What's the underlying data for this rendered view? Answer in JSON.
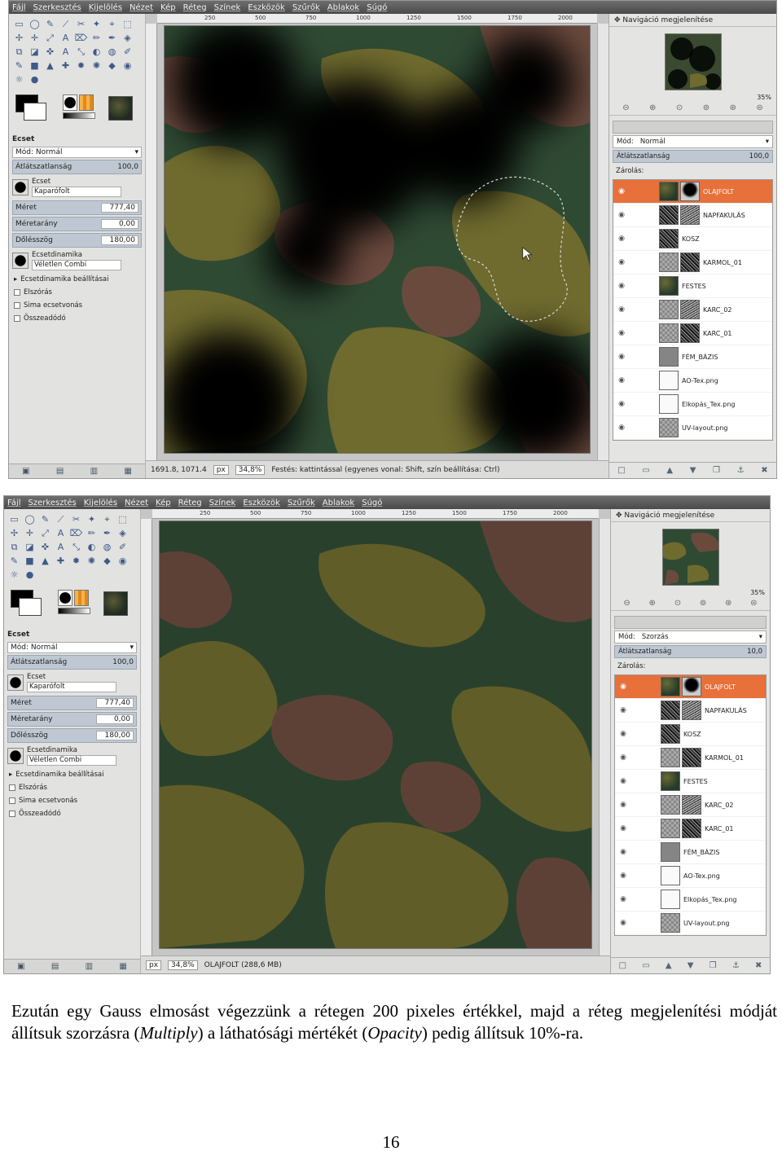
{
  "screenshot1": {
    "menu": [
      "Fájl",
      "Szerkesztés",
      "Kijelölés",
      "Nézet",
      "Kép",
      "Réteg",
      "Színek",
      "Eszközök",
      "Szűrők",
      "Ablakok",
      "Súgó"
    ],
    "ruler": [
      "250",
      "500",
      "750",
      "1000",
      "1250",
      "1500",
      "1750",
      "2000"
    ],
    "toolbox": {
      "section_title": "Ecset",
      "mode_label": "Mód:",
      "mode_value": "Normál",
      "opacity_label": "Átlátszatlanság",
      "opacity_value": "100,0",
      "brush_label": "Ecset",
      "brush_value": "Kaparófolt",
      "size_label": "Méret",
      "size_value": "777,40",
      "aspect_label": "Méretarány",
      "aspect_value": "0,00",
      "angle_label": "Dőlésszög",
      "angle_value": "180,00",
      "dynamics_label": "Ecsetdinamika",
      "dynamics_value": "Véletlen Combi",
      "dynamics_options": "Ecsetdinamika beállításai",
      "fade": "Elszórás",
      "smooth": "Sima ecsetvonás",
      "incremental": "Összeadódó"
    },
    "status": {
      "coords": "1691.8, 1071.4",
      "unit": "px",
      "zoom": "34,8%",
      "message": "Festés: kattintással (egyenes vonal: Shift, szín beállítása: Ctrl)"
    },
    "dock": {
      "nav_title": "Navigáció megjelenítése",
      "zoom": "35%",
      "mode_label": "Mód:",
      "mode_value": "Normál",
      "opacity_label": "Átlátszatlanság",
      "opacity_value": "100,0",
      "lock_label": "Zárolás:"
    }
  },
  "screenshot2": {
    "menu": [
      "Fájl",
      "Szerkesztés",
      "Kijelölés",
      "Nézet",
      "Kép",
      "Réteg",
      "Színek",
      "Eszközök",
      "Szűrők",
      "Ablakok",
      "Súgó"
    ],
    "ruler": [
      "250",
      "500",
      "750",
      "1000",
      "1250",
      "1500",
      "1750",
      "2000"
    ],
    "toolbox": {
      "section_title": "Ecset",
      "mode_label": "Mód:",
      "mode_value": "Normál",
      "opacity_label": "Átlátszatlanság",
      "opacity_value": "100,0",
      "brush_label": "Ecset",
      "brush_value": "Kaparófolt",
      "size_label": "Méret",
      "size_value": "777,40",
      "aspect_label": "Méretarány",
      "aspect_value": "0,00",
      "angle_label": "Dőlésszög",
      "angle_value": "180,00",
      "dynamics_label": "Ecsetdinamika",
      "dynamics_value": "Véletlen Combi",
      "dynamics_options": "Ecsetdinamika beállításai",
      "fade": "Elszórás",
      "smooth": "Sima ecsetvonás",
      "incremental": "Összeadódó"
    },
    "status": {
      "unit": "px",
      "zoom": "34,8%",
      "message": "OLAJFOLT (288,6 MB)"
    },
    "dock": {
      "nav_title": "Navigáció megjelenítése",
      "zoom": "35%",
      "mode_label": "Mód:",
      "mode_value": "Szorzás",
      "opacity_label": "Átlátszatlanság",
      "opacity_value": "10,0",
      "lock_label": "Zárolás:"
    }
  },
  "layers": [
    {
      "name": "OLAJFOLT",
      "thumb": "t-camo",
      "mask": "t-black",
      "selected": true
    },
    {
      "name": "NAPFAKULÁS",
      "thumb": "t-noise",
      "mask": "t-noise2"
    },
    {
      "name": "KOSZ",
      "thumb": "t-noise",
      "mask": ""
    },
    {
      "name": "KARMOL_01",
      "thumb": "t-check",
      "mask": "t-noise"
    },
    {
      "name": "FESTES",
      "thumb": "t-camo",
      "mask": ""
    },
    {
      "name": "KARC_02",
      "thumb": "t-check",
      "mask": "t-noise2"
    },
    {
      "name": "KARC_01",
      "thumb": "t-check",
      "mask": "t-noise"
    },
    {
      "name": "FÉM_BÁZIS",
      "thumb": "t-grey",
      "mask": ""
    },
    {
      "name": "AO-Tex.png",
      "thumb": "t-white",
      "mask": ""
    },
    {
      "name": "Elkopás_Tex.png",
      "thumb": "t-white",
      "mask": ""
    },
    {
      "name": "UV-layout.png",
      "thumb": "t-check",
      "mask": ""
    }
  ],
  "caption": {
    "part1": "Ezután egy Gauss elmosást végezzünk a rétegen 200 pixeles értékkel, majd a réteg megjelenítési módját állítsuk szorzásra (",
    "multiply": "Multiply",
    "part2": ") a láthatósági mértékét (",
    "opacity": "Opacity",
    "part3": ") pedig állítsuk 10%-ra."
  },
  "page_number": "16",
  "colors": {
    "selected_layer": "#e8703a",
    "camo_green": "#2f4a33",
    "camo_olive": "#6f6a2e",
    "camo_brown": "#6b4a3e"
  }
}
